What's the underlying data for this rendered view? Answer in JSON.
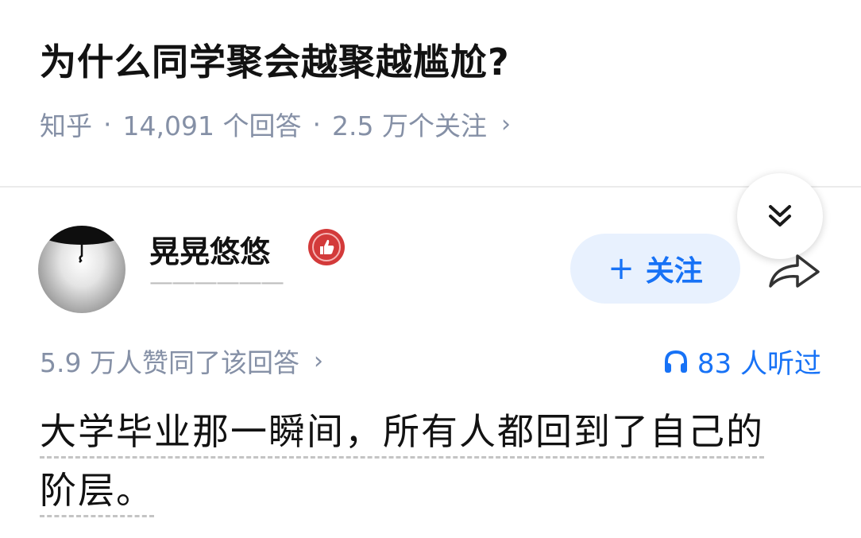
{
  "question": {
    "title": "为什么同学聚会越聚越尴尬?",
    "source": "知乎",
    "answer_count": "14,091 个回答",
    "follower_count": "2.5 万个关注",
    "chevron": "›"
  },
  "author": {
    "name": "晃晃悠悠",
    "headline": "——————",
    "follow_label": "关注",
    "follow_plus": "+"
  },
  "answer": {
    "upvote_summary": "5.9 万人赞同了该回答",
    "chevron": "›",
    "listen_count": "83 人听过",
    "text_line1": "大学毕业那一瞬间，所有人都回到了自己的",
    "text_line2": "阶层。"
  },
  "colors": {
    "accent": "#1772f6",
    "follow_bg": "#e8f1fe",
    "meta_gray": "#8590a6",
    "badge_red": "#d33a3a"
  },
  "icons": {
    "collapse": "chevron-double-down-icon",
    "share": "share-arrow-icon",
    "listen": "headphones-icon",
    "badge": "thumbs-up-badge-icon"
  }
}
